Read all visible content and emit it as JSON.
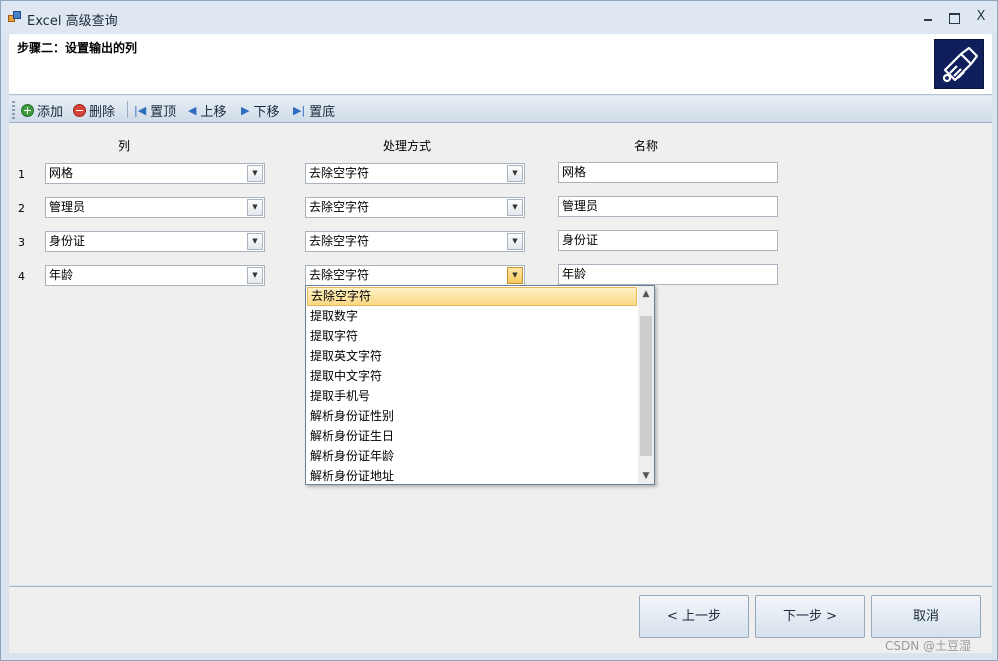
{
  "window": {
    "title": "Excel 高级查询",
    "controls": {
      "minimize": "",
      "maximize": "",
      "close": "X"
    }
  },
  "header": {
    "step_title": "步骤二：设置输出的列",
    "logo_icon": "wizard-logo-icon"
  },
  "toolbar": {
    "add": "添加",
    "delete": "删除",
    "top": "置顶",
    "up": "上移",
    "down": "下移",
    "bottom": "置底"
  },
  "columns": {
    "col": "列",
    "method": "处理方式",
    "name": "名称"
  },
  "rows": [
    {
      "num": "1",
      "column": "网格",
      "method": "去除空字符",
      "name": "网格"
    },
    {
      "num": "2",
      "column": "管理员",
      "method": "去除空字符",
      "name": "管理员"
    },
    {
      "num": "3",
      "column": "身份证",
      "method": "去除空字符",
      "name": "身份证"
    },
    {
      "num": "4",
      "column": "年龄",
      "method": "去除空字符",
      "name": "年龄"
    }
  ],
  "dropdown": {
    "selected": "去除空字符",
    "options": [
      "去除空字符",
      "提取数字",
      "提取字符",
      "提取英文字符",
      "提取中文字符",
      "提取手机号",
      "解析身份证性别",
      "解析身份证生日",
      "解析身份证年龄",
      "解析身份证地址"
    ]
  },
  "footer": {
    "prev": "< 上一步",
    "next": "下一步 >",
    "cancel": "取消"
  },
  "watermark": "CSDN @土豆湿",
  "colors": {
    "accent": "#f7c85c",
    "toolbar_blue": "#2f6cc0",
    "logo_bg": "#0f1f5c"
  }
}
